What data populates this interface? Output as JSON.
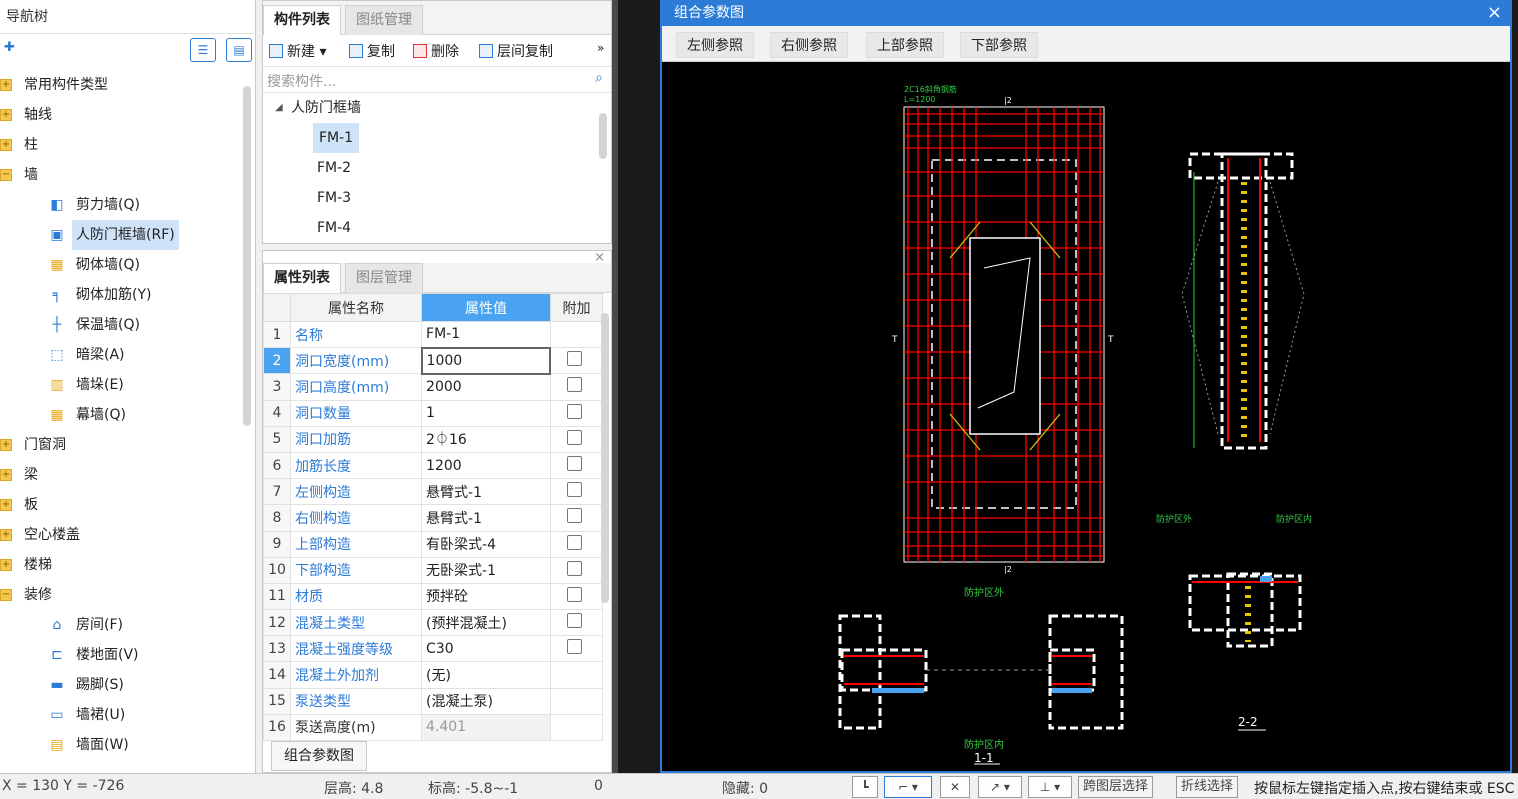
{
  "nav": {
    "title": "导航树",
    "tree": [
      {
        "label": "常用构件类型",
        "level": 1,
        "icon": "folder-plus-icon"
      },
      {
        "label": "轴线",
        "level": 1,
        "icon": "folder-plus-icon"
      },
      {
        "label": "柱",
        "level": 1,
        "icon": "folder-plus-icon"
      },
      {
        "label": "墙",
        "level": 1,
        "icon": "folder-minus-icon"
      },
      {
        "label": "剪力墙(Q)",
        "level": 2,
        "icon": "shear-wall-icon"
      },
      {
        "label": "人防门框墙(RF)",
        "level": 2,
        "icon": "door-frame-wall-icon",
        "selected": true
      },
      {
        "label": "砌体墙(Q)",
        "level": 2,
        "icon": "masonry-wall-icon"
      },
      {
        "label": "砌体加筋(Y)",
        "level": 2,
        "icon": "masonry-rebar-icon"
      },
      {
        "label": "保温墙(Q)",
        "level": 2,
        "icon": "insulation-wall-icon"
      },
      {
        "label": "暗梁(A)",
        "level": 2,
        "icon": "hidden-beam-icon"
      },
      {
        "label": "墙垛(E)",
        "level": 2,
        "icon": "wall-pier-icon"
      },
      {
        "label": "幕墙(Q)",
        "level": 2,
        "icon": "curtain-wall-icon"
      },
      {
        "label": "门窗洞",
        "level": 1,
        "icon": "folder-plus-icon"
      },
      {
        "label": "梁",
        "level": 1,
        "icon": "folder-plus-icon"
      },
      {
        "label": "板",
        "level": 1,
        "icon": "folder-plus-icon"
      },
      {
        "label": "空心楼盖",
        "level": 1,
        "icon": "folder-plus-icon"
      },
      {
        "label": "楼梯",
        "level": 1,
        "icon": "folder-plus-icon"
      },
      {
        "label": "装修",
        "level": 1,
        "icon": "folder-minus-icon"
      },
      {
        "label": "房间(F)",
        "level": 2,
        "icon": "room-icon"
      },
      {
        "label": "楼地面(V)",
        "level": 2,
        "icon": "floor-icon"
      },
      {
        "label": "踢脚(S)",
        "level": 2,
        "icon": "skirting-icon"
      },
      {
        "label": "墙裙(U)",
        "level": 2,
        "icon": "dado-icon"
      },
      {
        "label": "墙面(W)",
        "level": 2,
        "icon": "wall-surface-icon"
      }
    ]
  },
  "components": {
    "tabs": [
      "构件列表",
      "图纸管理"
    ],
    "toolbar": {
      "new": "新建",
      "copy": "复制",
      "delete": "删除",
      "floor_copy": "层间复制",
      "more": "»"
    },
    "search_placeholder": "搜索构件...",
    "group": "人防门框墙",
    "items": [
      "FM-1",
      "FM-2",
      "FM-3",
      "FM-4"
    ]
  },
  "properties": {
    "tabs": [
      "属性列表",
      "图层管理"
    ],
    "headers": {
      "name": "属性名称",
      "value": "属性值",
      "extra": "附加"
    },
    "rows": [
      {
        "n": "1",
        "name": "名称",
        "value": "FM-1",
        "check": false,
        "blue": true
      },
      {
        "n": "2",
        "name": "洞口宽度(mm)",
        "value": "1000",
        "check": true,
        "blue": true,
        "selected": true
      },
      {
        "n": "3",
        "name": "洞口高度(mm)",
        "value": "2000",
        "check": true,
        "blue": true
      },
      {
        "n": "4",
        "name": "洞口数量",
        "value": "1",
        "check": true,
        "blue": true
      },
      {
        "n": "5",
        "name": "洞口加筋",
        "value": "2⏀16",
        "check": true,
        "blue": true
      },
      {
        "n": "6",
        "name": "加筋长度",
        "value": "1200",
        "check": true,
        "blue": true
      },
      {
        "n": "7",
        "name": "左侧构造",
        "value": "悬臂式-1",
        "check": true,
        "blue": true
      },
      {
        "n": "8",
        "name": "右侧构造",
        "value": "悬臂式-1",
        "check": true,
        "blue": true
      },
      {
        "n": "9",
        "name": "上部构造",
        "value": "有卧梁式-4",
        "check": true,
        "blue": true
      },
      {
        "n": "10",
        "name": "下部构造",
        "value": "无卧梁式-1",
        "check": true,
        "blue": true
      },
      {
        "n": "11",
        "name": "材质",
        "value": "预拌砼",
        "check": true,
        "blue": true
      },
      {
        "n": "12",
        "name": "混凝土类型",
        "value": "(预拌混凝土)",
        "check": true,
        "blue": true
      },
      {
        "n": "13",
        "name": "混凝土强度等级",
        "value": "C30",
        "check": true,
        "blue": true
      },
      {
        "n": "14",
        "name": "混凝土外加剂",
        "value": "(无)",
        "check": false,
        "blue": true
      },
      {
        "n": "15",
        "name": "泵送类型",
        "value": "(混凝土泵)",
        "check": false,
        "blue": true
      },
      {
        "n": "16",
        "name": "泵送高度(m)",
        "value": "4.401",
        "check": false,
        "blue": false,
        "gray": true
      }
    ],
    "combo_button": "组合参数图"
  },
  "dialog": {
    "title": "组合参数图",
    "close": "×",
    "buttons": [
      "左侧参照",
      "右侧参照",
      "上部参照",
      "下部参照"
    ],
    "drawing": {
      "note1": "2C16斜角钢筋",
      "note2": "L=1200",
      "dim_top": "|2",
      "dim_bottom": "|2",
      "side_mark_left": "T",
      "side_mark_right": "T",
      "zone_out": "防护区外",
      "zone_out_label": "防护区外",
      "zone_in_label": "防护区内",
      "zone_in_bottom": "防护区内",
      "section_22": "2-2",
      "section_11": "1-1"
    }
  },
  "status": {
    "coords": "X = 130 Y = -726",
    "floor_height": "层高:  4.8",
    "elevation": "标高:  -5.8~-1",
    "zero": "0",
    "hidden": "隐藏:  0",
    "cross_layer": "跨图层选择",
    "polyline": "折线选择",
    "hint": "按鼠标左键指定插入点,按右键结束或 ESC"
  },
  "colors": {
    "accent": "#2c7bd6",
    "header_blue": "#4aa3f0",
    "cad_bg": "#000000",
    "rebar_red": "#ff0000",
    "outline_white": "#ffffff"
  }
}
